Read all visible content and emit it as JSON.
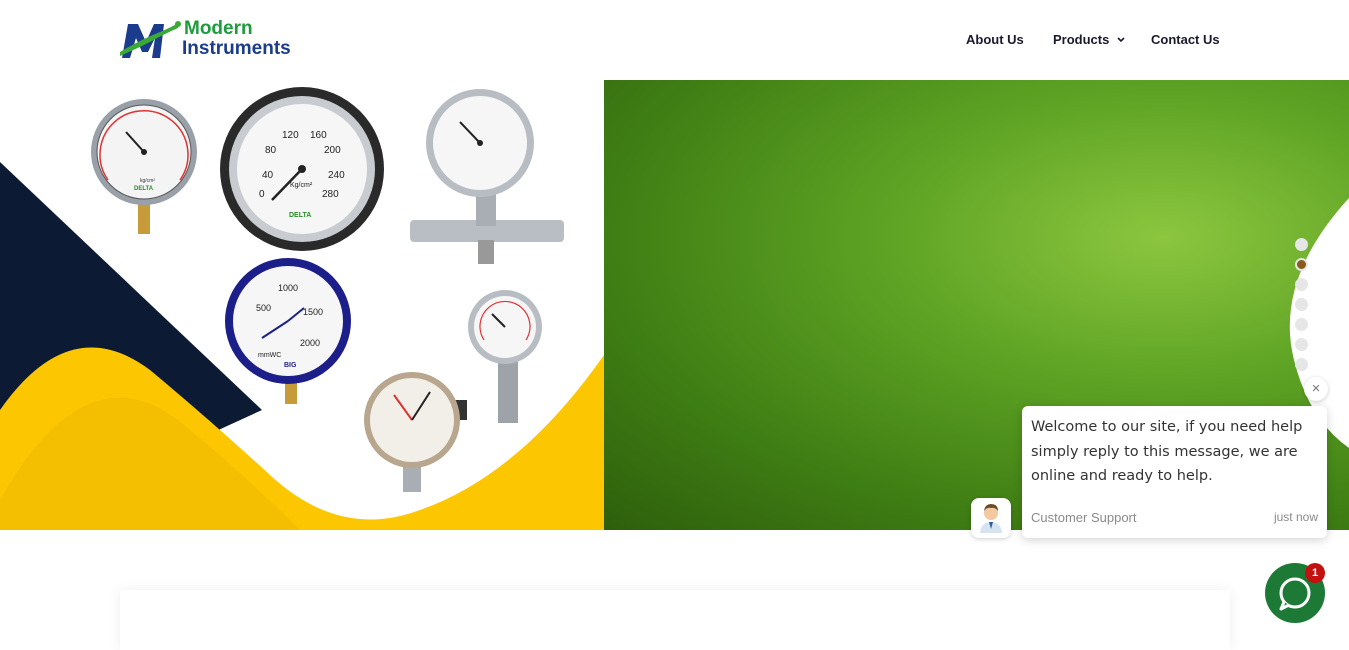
{
  "brand": {
    "line1": "Modern",
    "line2": "Instruments"
  },
  "nav": {
    "about": "About Us",
    "products": "Products",
    "contact": "Contact Us"
  },
  "hero": {
    "active_slide": 2,
    "slide_count": 7,
    "gauges": {
      "g1_brand": "DELTA",
      "g1_unit": "kg/cm²",
      "g2_brand": "DELTA",
      "g2_unit": "Kg/cm²",
      "g2_ticks": [
        "0",
        "40",
        "80",
        "120",
        "160",
        "200",
        "240",
        "280"
      ],
      "g4_ticks": [
        "1000",
        "500",
        "1500",
        "2000"
      ],
      "g4_unit": "mmWC",
      "g4_brand": "BIG"
    }
  },
  "chat": {
    "message": "Welcome to our site, if you need help simply reply to this message, we are online and ready to help.",
    "agent": "Customer Support",
    "time": "just now",
    "close_icon": "×",
    "badge_count": "1"
  },
  "colors": {
    "navy": "#0c1a33",
    "yellow": "#fcc700",
    "green": "#5ea324",
    "chat_green": "#1d7a36",
    "badge_red": "#c41010"
  }
}
